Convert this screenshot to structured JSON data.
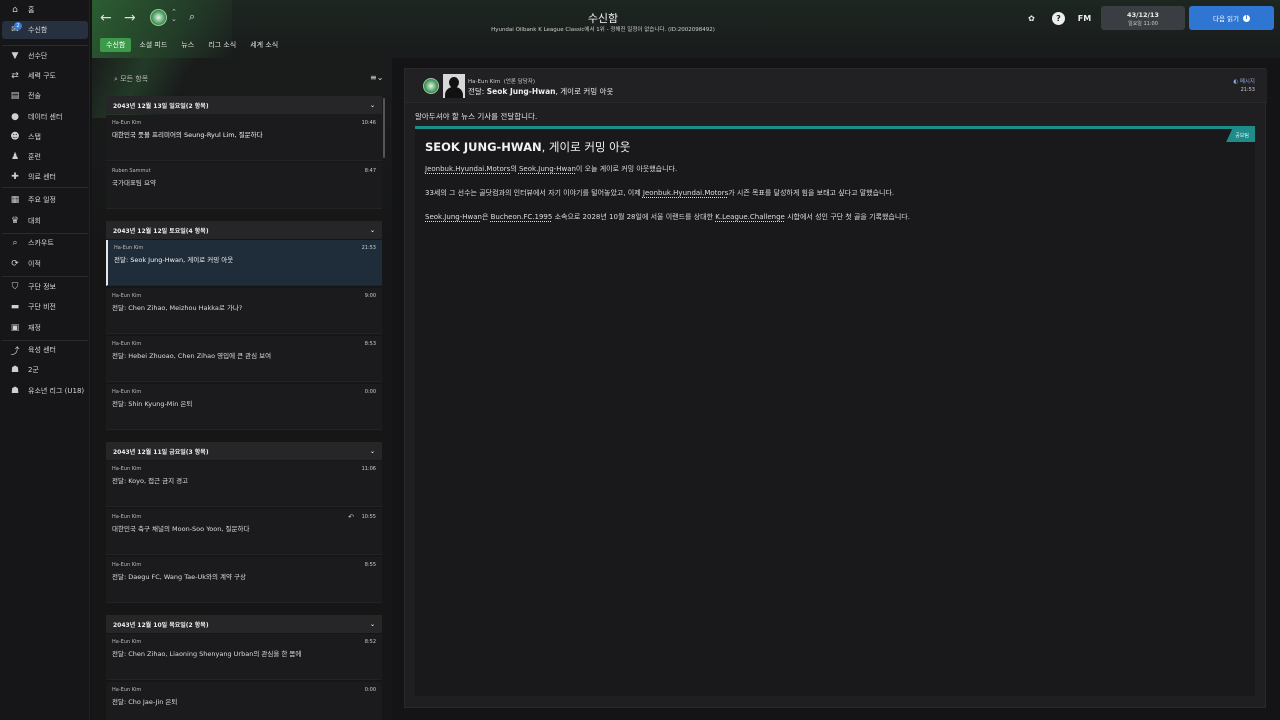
{
  "sidebar": {
    "items": [
      {
        "label": "홈",
        "icon": "home-icon",
        "glyph": "⌂"
      },
      {
        "label": "수신함",
        "icon": "inbox-icon",
        "glyph": "✉",
        "badge": "2"
      },
      {
        "label": "선수단",
        "icon": "shirt-icon",
        "glyph": "▼"
      },
      {
        "label": "세력 구도",
        "icon": "tactics-icon",
        "glyph": "⇄"
      },
      {
        "label": "전술",
        "icon": "clipboard-icon",
        "glyph": "▤"
      },
      {
        "label": "데이터 센터",
        "icon": "data-center-icon",
        "glyph": "●"
      },
      {
        "label": "스탭",
        "icon": "staff-icon",
        "glyph": "☻"
      },
      {
        "label": "훈련",
        "icon": "training-icon",
        "glyph": "♟"
      },
      {
        "label": "의료 센터",
        "icon": "medical-icon",
        "glyph": "✚"
      },
      {
        "label": "주요 일정",
        "icon": "calendar-icon",
        "glyph": "▦"
      },
      {
        "label": "대회",
        "icon": "trophy-icon",
        "glyph": "♛"
      },
      {
        "label": "스카우트",
        "icon": "scout-icon",
        "glyph": "⌕"
      },
      {
        "label": "이적",
        "icon": "transfer-icon",
        "glyph": "⟳"
      },
      {
        "label": "구단 정보",
        "icon": "club-info-icon",
        "glyph": "⛉"
      },
      {
        "label": "구단 비전",
        "icon": "vision-icon",
        "glyph": "▬"
      },
      {
        "label": "재정",
        "icon": "finance-icon",
        "glyph": "▣"
      },
      {
        "label": "육성 센터",
        "icon": "development-icon",
        "glyph": "⤴"
      },
      {
        "label": "2군",
        "icon": "reserve-team-icon",
        "glyph": "☗"
      },
      {
        "label": "유소년 리그 (U18)",
        "icon": "youth-team-icon",
        "glyph": "☗"
      }
    ]
  },
  "header": {
    "title": "수신함",
    "subtitle": "Hyundai Oilbank K League Classic에서 1위 - 정해진 일정이 없습니다. (ID:2002098492)",
    "date": "43/12/13",
    "weekday_time": "일요일 11:00",
    "continue_label": "다음 읽기",
    "fm_label": "FM",
    "help_label": "?",
    "tabs": [
      "수신함",
      "소셜 피드",
      "뉴스",
      "리그 소식",
      "세계 소식"
    ]
  },
  "inbox": {
    "search_placeholder": "모든 항목",
    "groups": [
      {
        "header": "2043년 12월 13일 일요일(2 항목)",
        "messages": [
          {
            "from": "Ha-Eun Kim",
            "subject": "대한민국 풋볼 프리미어의 Seung-Ryul Lim, 질문하다",
            "time": "10:46"
          },
          {
            "from": "Ruben Sammut",
            "subject": "국가대표팀 요약",
            "time": "8:47"
          }
        ]
      },
      {
        "header": "2043년 12월 12일 토요일(4 항목)",
        "messages": [
          {
            "from": "Ha-Eun Kim",
            "subject": "전달: Seok Jung-Hwan, 게이로 커밍 아웃",
            "time": "21:53",
            "selected": true
          },
          {
            "from": "Ha-Eun Kim",
            "subject": "전달: Chen Zihao, Meizhou Hakka로 가나?",
            "time": "9:00"
          },
          {
            "from": "Ha-Eun Kim",
            "subject": "전달: Hebei Zhuoao, Chen Zihao 영입에 큰 관심 보여",
            "time": "8:53"
          },
          {
            "from": "Ha-Eun Kim",
            "subject": "전달: Shin Kyung-Min 은퇴",
            "time": "0:00"
          }
        ]
      },
      {
        "header": "2043년 12월 11일 금요일(3 항목)",
        "messages": [
          {
            "from": "Ha-Eun Kim",
            "subject": "전달: Koyo, 접근 금지 경고",
            "time": "11:06"
          },
          {
            "from": "Ha-Eun Kim",
            "subject": "대한민국 축구 채널의 Moon-Soo Yoon, 질문하다",
            "time": "10:55",
            "replied": true
          },
          {
            "from": "Ha-Eun Kim",
            "subject": "전달: Daegu FC, Wang Tae-Uk와의 계약 구상",
            "time": "8:55"
          }
        ]
      },
      {
        "header": "2043년 12월 10일 목요일(2 항목)",
        "messages": [
          {
            "from": "Ha-Eun Kim",
            "subject": "전달: Chen Zihao, Liaoning Shenyang Urban의 관심을 한 몸에",
            "time": "8:52"
          },
          {
            "from": "Ha-Eun Kim",
            "subject": "전달: Cho Jae-Jin 은퇴",
            "time": "0:00"
          }
        ]
      }
    ]
  },
  "message": {
    "from": "Ha-Eun Kim",
    "role": "(언론 담당자)",
    "subject_prefix": "전달: ",
    "subject_name": "Seok Jung-Hwan",
    "subject_rest": ", 게이로 커밍 아웃",
    "tag": "메시지",
    "time": "21:53",
    "intro": "알아두셔야 할 뉴스 기사를 전달합니다.",
    "article": {
      "tag": "공보팀",
      "title_bold": "SEOK JUNG-HWAN",
      "title_rest": ", 게이로 커밍 아웃",
      "p1_a": "Jeonbuk.Hyundai.Motors",
      "p1_b": "의 ",
      "p1_c": "Seok.Jung-Hwan",
      "p1_d": "이 오늘 게이로 커밍 아웃했습니다.",
      "p2_a": "33세의 그 선수는 골닷컴과의 인터뷰에서 자기 이야기를 털어놓았고, 이제 ",
      "p2_b": "Jeonbuk.Hyundai.Motors",
      "p2_c": "가 시즌 목표를 달성하게 힘을 보태고 싶다고 말했습니다.",
      "p3_a": "Seok.Jung-Hwan",
      "p3_b": "은 ",
      "p3_c": "Bucheon.FC.1995",
      "p3_d": " 소속으로 2028년 10월 28일에 서울 이랜드를 상대한 ",
      "p3_e": "K.League.Challenge",
      "p3_f": " 시합에서 성인 구단 첫 골을 기록했습니다."
    }
  },
  "colors": {
    "accent_green": "#3d9a4a",
    "continue_blue": "#2f76d3",
    "news_teal": "#1f8c8c"
  }
}
